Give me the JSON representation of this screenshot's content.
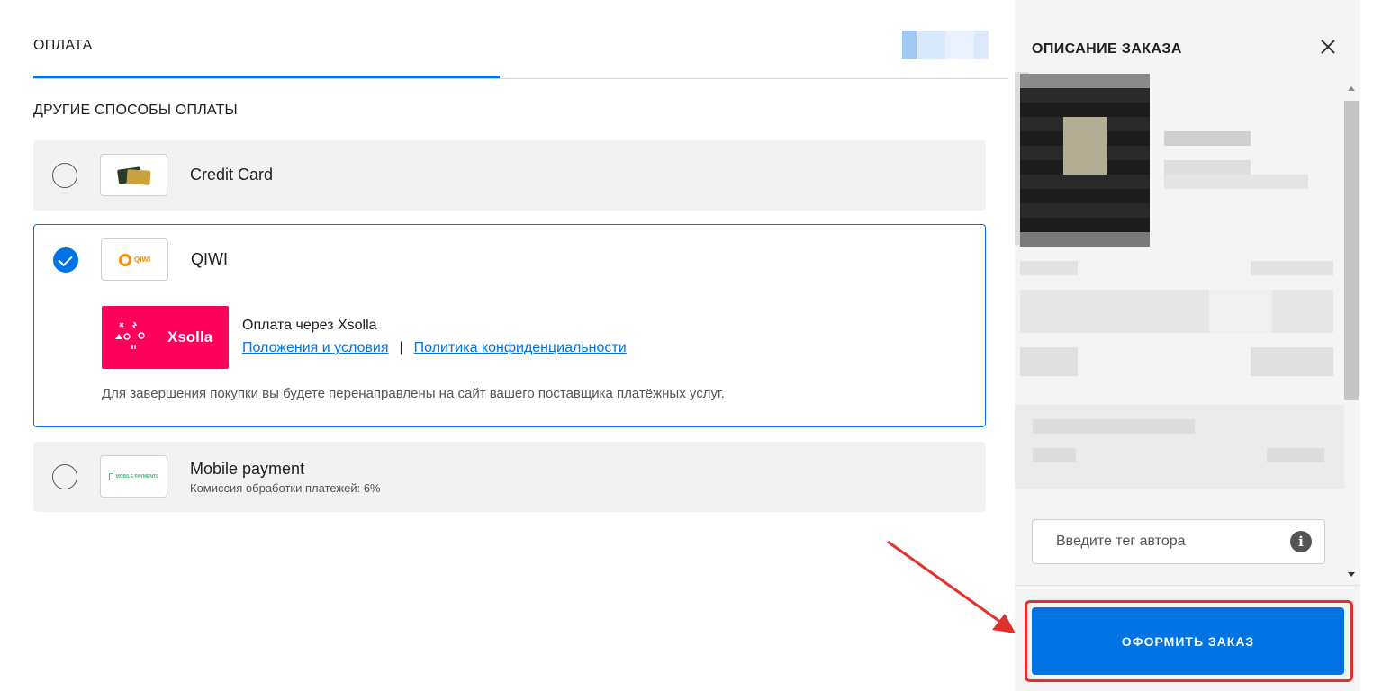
{
  "header": {
    "tab_title": "ОПЛАТА"
  },
  "payment": {
    "section_title": "ДРУГИЕ СПОСОБЫ ОПЛАТЫ",
    "methods": [
      {
        "label": "Credit Card",
        "selected": false,
        "icon": "credit-cards-icon"
      },
      {
        "label": "QIWI",
        "selected": true,
        "icon": "qiwi-logo-icon",
        "logo_text": "QIWI"
      },
      {
        "label": "Mobile payment",
        "selected": false,
        "icon": "mobile-payments-icon",
        "sublabel": "Комиссия обработки платежей: 6%",
        "logo_text": "MOBILE PAYMENTS"
      }
    ],
    "xsolla": {
      "logo_text": "Xsolla",
      "via_text": "Оплата через Xsolla",
      "terms_link": "Положения и условия",
      "separator": "|",
      "privacy_link": "Политика конфиденциальности",
      "redirect_note": "Для завершения покупки вы будете перенаправлены на сайт вашего поставщика платёжных услуг."
    }
  },
  "summary": {
    "title": "ОПИСАНИЕ ЗАКАЗА",
    "creator_tag_placeholder": "Введите тег автора",
    "info_glyph": "i",
    "order_button": "ОФОРМИТЬ ЗАКАЗ"
  },
  "colors": {
    "accent": "#0074e4",
    "xsolla": "#ff005b",
    "annotation": "#e0302a"
  }
}
